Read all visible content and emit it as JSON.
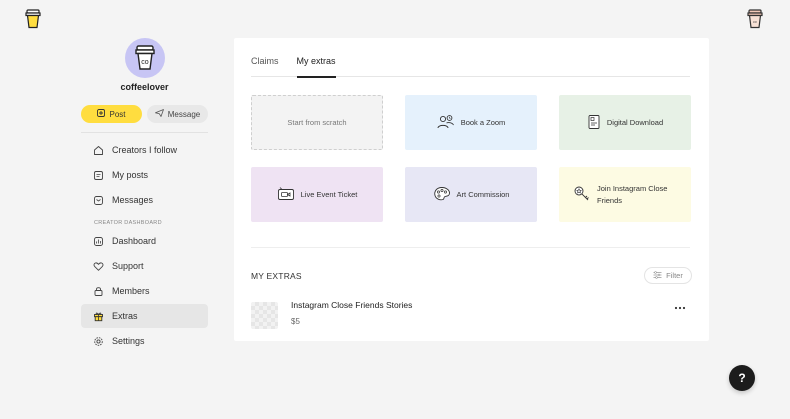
{
  "brand": {
    "logo_icon": "coffee-cup-icon",
    "accent": "#ffdd3f"
  },
  "profile": {
    "username": "coffeelover",
    "avatar_bg": "#c7c5f4"
  },
  "actions": {
    "post_label": "Post",
    "message_label": "Message"
  },
  "nav": {
    "items": [
      {
        "label": "Creators I follow",
        "icon": "home-icon"
      },
      {
        "label": "My posts",
        "icon": "posts-icon"
      },
      {
        "label": "Messages",
        "icon": "messages-icon"
      }
    ],
    "section_label": "CREATOR DASHBOARD",
    "dashboard_items": [
      {
        "label": "Dashboard",
        "icon": "dashboard-icon"
      },
      {
        "label": "Support",
        "icon": "heart-icon"
      },
      {
        "label": "Members",
        "icon": "lock-icon"
      },
      {
        "label": "Extras",
        "icon": "gift-icon",
        "active": true
      },
      {
        "label": "Settings",
        "icon": "gear-icon"
      }
    ]
  },
  "tabs": [
    {
      "label": "Claims",
      "active": false
    },
    {
      "label": "My extras",
      "active": true
    }
  ],
  "cards": [
    {
      "label": "Start from scratch",
      "icon": "",
      "bg": "#f3f3f3"
    },
    {
      "label": "Book a Zoom",
      "icon": "people-icon",
      "bg": "#e5f1fc"
    },
    {
      "label": "Digital Download",
      "icon": "document-icon",
      "bg": "#e7f1e6"
    },
    {
      "label": "Live Event Ticket",
      "icon": "video-ticket-icon",
      "bg": "#efe3f3"
    },
    {
      "label": "Art Commission",
      "icon": "palette-icon",
      "bg": "#e7e7f5"
    },
    {
      "label": "Join Instagram Close Friends",
      "icon": "star-key-icon",
      "bg": "#fdfbe3"
    }
  ],
  "extras": {
    "title": "MY EXTRAS",
    "filter_label": "Filter",
    "items": [
      {
        "name": "Instagram Close Friends Stories",
        "price": "$5"
      }
    ]
  },
  "help": {
    "label": "?"
  }
}
